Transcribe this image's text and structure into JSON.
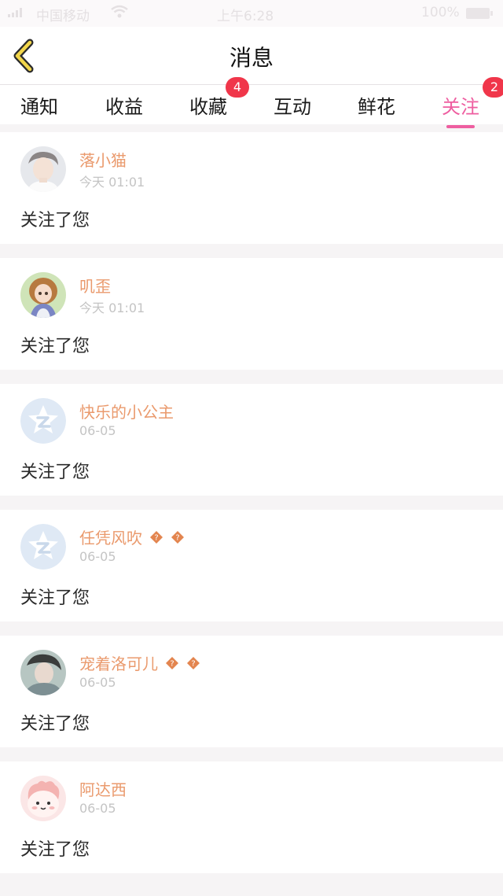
{
  "status_bar": {
    "carrier": "中国移动",
    "time": "上午6:28",
    "battery": "100%"
  },
  "header": {
    "title": "消息"
  },
  "tabs": [
    {
      "label": "通知",
      "badge": null,
      "active": false
    },
    {
      "label": "收益",
      "badge": null,
      "active": false
    },
    {
      "label": "收藏",
      "badge": "4",
      "active": false
    },
    {
      "label": "互动",
      "badge": null,
      "active": false
    },
    {
      "label": "鲜花",
      "badge": null,
      "active": false
    },
    {
      "label": "关注",
      "badge": "2",
      "active": true
    }
  ],
  "items": [
    {
      "name": "落小猫",
      "time": "今天 01:01",
      "message": "关注了您",
      "avatar": "boy-photo",
      "vip": false
    },
    {
      "name": "叽歪",
      "time": "今天 01:01",
      "message": "关注了您",
      "avatar": "girl-cartoon",
      "vip": false
    },
    {
      "name": "快乐的小公主",
      "time": "06-05",
      "message": "关注了您",
      "avatar": "qq-default-icon",
      "vip": false
    },
    {
      "name": "任凭风吹",
      "time": "06-05",
      "message": "关注了您",
      "avatar": "qq-default-icon",
      "vip": true
    },
    {
      "name": "宠着洛可儿",
      "time": "06-05",
      "message": "关注了您",
      "avatar": "person-photo",
      "vip": true
    },
    {
      "name": "阿达西",
      "time": "06-05",
      "message": "关注了您",
      "avatar": "pink-blob-cartoon",
      "vip": false
    }
  ],
  "colors": {
    "accent": "#ee5ea0",
    "badge": "#f0364a",
    "username": "#ea9a6d",
    "back_arrow": "#f2d64b"
  }
}
